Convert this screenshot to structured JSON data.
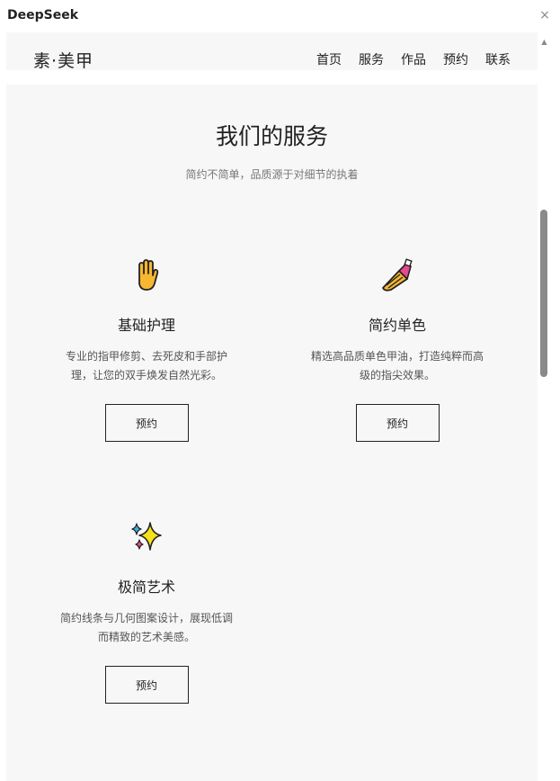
{
  "window": {
    "title": "DeepSeek",
    "close_icon": "×"
  },
  "site": {
    "logo": "素·美甲",
    "nav": [
      "首页",
      "服务",
      "作品",
      "预约",
      "联系"
    ]
  },
  "services_section": {
    "title": "我们的服务",
    "subtitle": "简约不简单，品质源于对细节的执着",
    "cards": [
      {
        "icon": "raised-hand-icon",
        "title": "基础护理",
        "description": "专业的指甲修剪、去死皮和手部护理，让您的双手焕发自然光彩。",
        "button": "预约"
      },
      {
        "icon": "nail-polish-icon",
        "title": "简约单色",
        "description": "精选高品质单色甲油，打造纯粹而高级的指尖效果。",
        "button": "预约"
      },
      {
        "icon": "sparkles-icon",
        "title": "极简艺术",
        "description": "简约线条与几何图案设计，展现低调而精致的艺术美感。",
        "button": "预约"
      }
    ]
  },
  "colors": {
    "page_background": "#f7f7f7",
    "text": "#222222",
    "muted_text": "#777777",
    "scrollbar_thumb": "#8a8a8a"
  }
}
